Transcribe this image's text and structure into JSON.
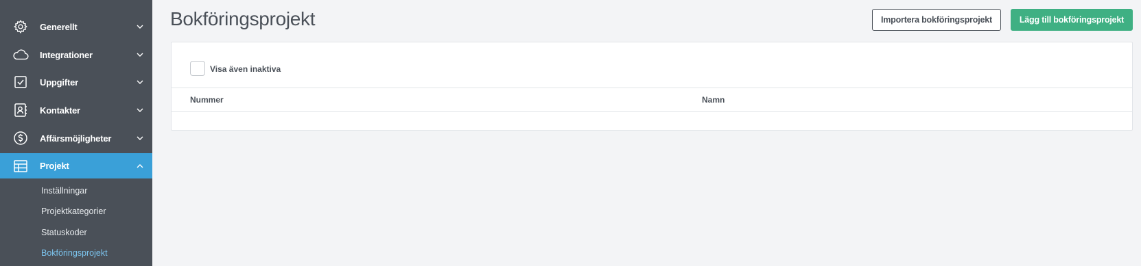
{
  "sidebar": {
    "items": [
      {
        "label": "Generellt",
        "icon": "gear-icon"
      },
      {
        "label": "Integrationer",
        "icon": "cloud-icon"
      },
      {
        "label": "Uppgifter",
        "icon": "checkbox-icon"
      },
      {
        "label": "Kontakter",
        "icon": "contact-book-icon"
      },
      {
        "label": "Affärsmöjligheter",
        "icon": "dollar-icon"
      },
      {
        "label": "Projekt",
        "icon": "table-icon",
        "active": true
      }
    ],
    "subitems": [
      {
        "label": "Inställningar"
      },
      {
        "label": "Projektkategorier"
      },
      {
        "label": "Statuskoder"
      },
      {
        "label": "Bokföringsprojekt",
        "current": true
      }
    ]
  },
  "header": {
    "title": "Bokföringsprojekt",
    "import_label": "Importera bokföringsprojekt",
    "add_label": "Lägg till bokföringsprojekt"
  },
  "filter": {
    "show_inactive_label": "Visa även inaktiva",
    "show_inactive_checked": false
  },
  "table": {
    "columns": [
      "Nummer",
      "Namn"
    ],
    "rows": []
  },
  "colors": {
    "sidebar_bg": "#4a5058",
    "active_bg": "#3aa0d8",
    "current_sub": "#7cc4ee",
    "primary_button": "#3fb083",
    "page_bg": "#f3f4f6"
  }
}
